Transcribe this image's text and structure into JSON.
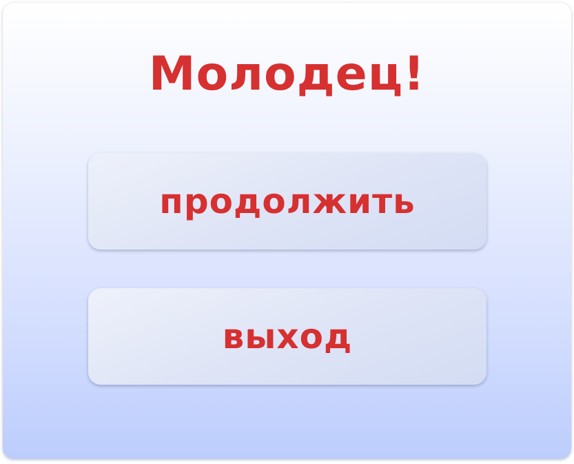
{
  "dialog": {
    "title": "Молодец!",
    "buttons": {
      "continue_label": "продолжить",
      "exit_label": "выход"
    }
  },
  "colors": {
    "text_accent": "#d63030",
    "background_top": "#ffffff",
    "background_bottom": "#bccdfd",
    "button_fill": "#dfe5f6"
  }
}
